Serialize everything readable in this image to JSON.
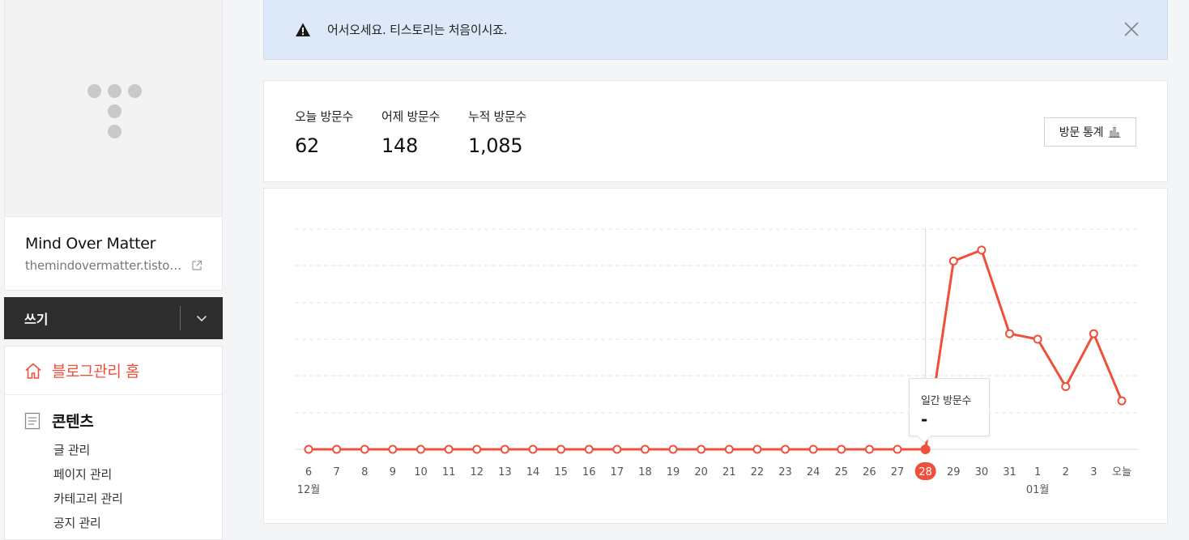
{
  "sidebar": {
    "blog_title": "Mind Over Matter",
    "blog_url": "themindovermatter.tistory.com",
    "write_label": "쓰기",
    "home_label": "블로그관리 홈",
    "content_section": {
      "label": "콘텐츠",
      "items": [
        "글 관리",
        "페이지 관리",
        "카테고리 관리",
        "공지 관리"
      ]
    }
  },
  "notice": {
    "text": "어서오세요. 티스토리는 처음이시죠."
  },
  "stats": {
    "today_label": "오늘 방문수",
    "today_value": "62",
    "yesterday_label": "어제 방문수",
    "yesterday_value": "148",
    "total_label": "누적 방문수",
    "total_value": "1,085",
    "button_label": "방문 통계"
  },
  "tooltip": {
    "label": "일간 방문수",
    "value": "-"
  },
  "colors": {
    "accent": "#f04f3b",
    "notice_bg": "#dde9f8"
  },
  "chart_data": {
    "type": "line",
    "categories": [
      "6",
      "7",
      "8",
      "9",
      "10",
      "11",
      "12",
      "13",
      "14",
      "15",
      "16",
      "17",
      "18",
      "19",
      "20",
      "21",
      "22",
      "23",
      "24",
      "25",
      "26",
      "27",
      "28",
      "29",
      "30",
      "31",
      "1",
      "2",
      "3",
      "오늘"
    ],
    "month_labels": [
      {
        "index": 0,
        "label": "12월"
      },
      {
        "index": 26,
        "label": "01월"
      }
    ],
    "highlight_index": 22,
    "series": [
      {
        "values": [
          0,
          0,
          0,
          0,
          0,
          0,
          0,
          0,
          0,
          0,
          0,
          0,
          0,
          0,
          0,
          0,
          0,
          0,
          0,
          0,
          0,
          0,
          0,
          171,
          181,
          105,
          100,
          57,
          105,
          44
        ]
      }
    ],
    "ylim": [
      0,
      200
    ],
    "grid": true
  }
}
